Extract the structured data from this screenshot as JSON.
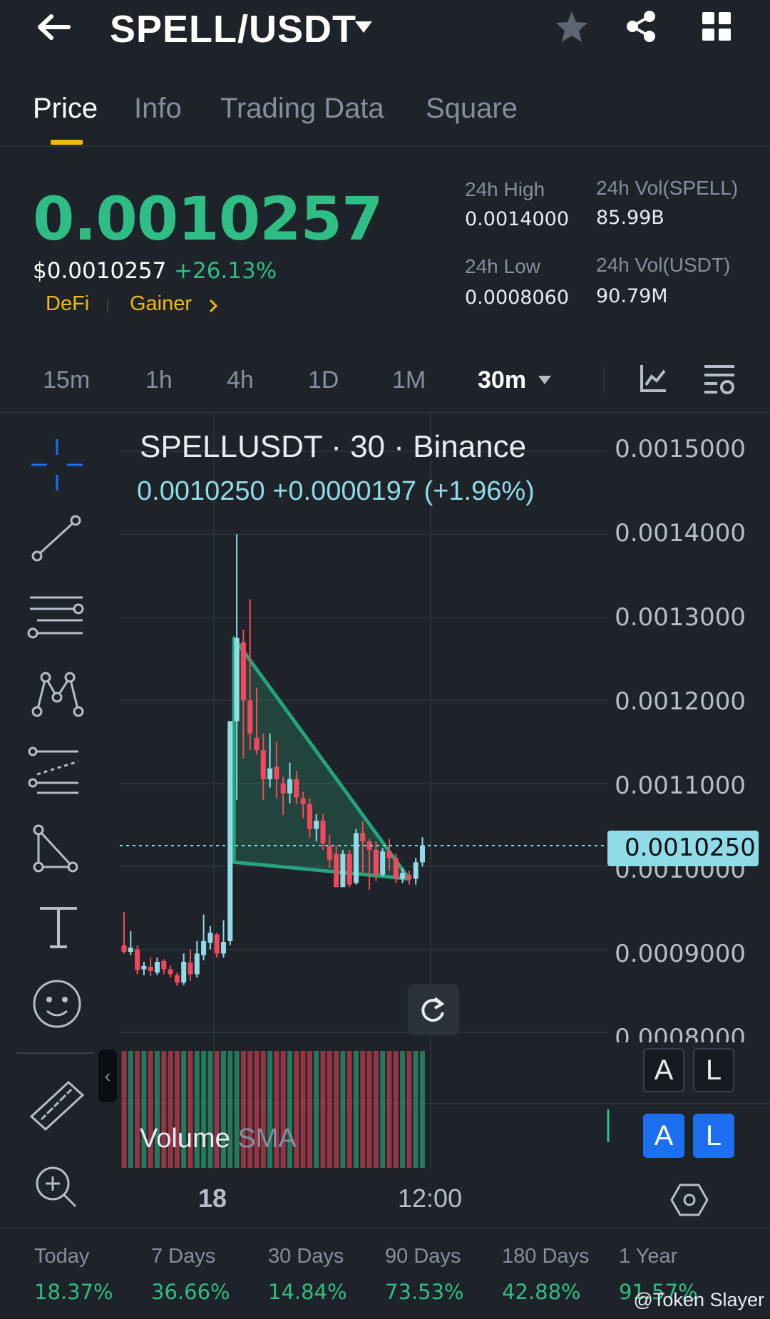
{
  "header": {
    "back_icon": "arrow-left-icon",
    "pair": "SPELL/USDT",
    "dropdown_icon": "caret-down-icon",
    "actions": [
      "star-icon",
      "share-icon",
      "grid-icon"
    ]
  },
  "tabs": [
    {
      "label": "Price",
      "active": true
    },
    {
      "label": "Info"
    },
    {
      "label": "Trading Data"
    },
    {
      "label": "Square"
    }
  ],
  "ticker": {
    "last_price": "0.0010257",
    "usd_price": "$0.0010257",
    "change_pct": "+26.13%",
    "tags": [
      "DeFi",
      "Gainer"
    ],
    "high_label": "24h High",
    "high_value": "0.0014000",
    "low_label": "24h Low",
    "low_value": "0.0008060",
    "vol_base_label": "24h Vol(SPELL)",
    "vol_base_value": "85.99B",
    "vol_quote_label": "24h Vol(USDT)",
    "vol_quote_value": "90.79M",
    "color_up": "#2ebd85",
    "color_down": "#f6465d",
    "accent": "#f0b90b"
  },
  "timeframes": {
    "items": [
      "15m",
      "1h",
      "4h",
      "1D",
      "1M"
    ],
    "selected": "30m"
  },
  "chart": {
    "title": "SPELLUSDT · 30 · Binance",
    "ohlc_line": "0.0010250  +0.0000197 (+1.96%)",
    "last_price_label": "0.0010250",
    "volume_label": "Volume",
    "volume_sma_label": "SMA",
    "x_labels": [
      "18",
      "12:00"
    ],
    "y_labels": [
      "0.0015000",
      "0.0014000",
      "0.0013000",
      "0.0012000",
      "0.0011000",
      "0.0010000",
      "0.0009000",
      "0.0008000"
    ],
    "buttons": {
      "a_dark": "A",
      "l_dark": "L",
      "a_blue": "A",
      "l_blue": "L"
    }
  },
  "chart_data": {
    "type": "candlestick",
    "title": "SPELLUSDT · 30 · Binance",
    "x_ticks": [
      "18",
      "12:00"
    ],
    "ylim": [
      0.0008,
      0.0015
    ],
    "last": 0.001025,
    "series": [
      {
        "o": 0.000905,
        "h": 0.000945,
        "l": 0.000895,
        "c": 0.000897
      },
      {
        "o": 0.000897,
        "h": 0.000922,
        "l": 0.000893,
        "c": 0.000902
      },
      {
        "o": 0.0009,
        "h": 0.000905,
        "l": 0.00087,
        "c": 0.000875
      },
      {
        "o": 0.000876,
        "h": 0.000885,
        "l": 0.000869,
        "c": 0.00088
      },
      {
        "o": 0.000879,
        "h": 0.00089,
        "l": 0.000868,
        "c": 0.000874
      },
      {
        "o": 0.000872,
        "h": 0.00089,
        "l": 0.000869,
        "c": 0.000885
      },
      {
        "o": 0.000886,
        "h": 0.000888,
        "l": 0.00087,
        "c": 0.000876
      },
      {
        "o": 0.000876,
        "h": 0.00088,
        "l": 0.000866,
        "c": 0.00087
      },
      {
        "o": 0.000869,
        "h": 0.000872,
        "l": 0.000856,
        "c": 0.00086
      },
      {
        "o": 0.00086,
        "h": 0.000895,
        "l": 0.000857,
        "c": 0.000885
      },
      {
        "o": 0.000884,
        "h": 0.0009,
        "l": 0.000862,
        "c": 0.00087
      },
      {
        "o": 0.00087,
        "h": 0.00091,
        "l": 0.000866,
        "c": 0.000895
      },
      {
        "o": 0.000893,
        "h": 0.000942,
        "l": 0.000887,
        "c": 0.00091
      },
      {
        "o": 0.000908,
        "h": 0.000928,
        "l": 0.0009,
        "c": 0.00092
      },
      {
        "o": 0.000918,
        "h": 0.00092,
        "l": 0.00089,
        "c": 0.000895
      },
      {
        "o": 0.000895,
        "h": 0.000935,
        "l": 0.00089,
        "c": 0.000909
      },
      {
        "o": 0.00091,
        "h": 0.001175,
        "l": 0.000905,
        "c": 0.001175
      },
      {
        "o": 0.001175,
        "h": 0.0014,
        "l": 0.00108,
        "c": 0.001275
      },
      {
        "o": 0.00127,
        "h": 0.001285,
        "l": 0.00113,
        "c": 0.0012
      },
      {
        "o": 0.0012,
        "h": 0.001322,
        "l": 0.00114,
        "c": 0.00116
      },
      {
        "o": 0.001155,
        "h": 0.001215,
        "l": 0.001135,
        "c": 0.00114
      },
      {
        "o": 0.00114,
        "h": 0.00116,
        "l": 0.00108,
        "c": 0.001105
      },
      {
        "o": 0.001105,
        "h": 0.00116,
        "l": 0.001095,
        "c": 0.001118
      },
      {
        "o": 0.00112,
        "h": 0.00115,
        "l": 0.001082,
        "c": 0.001105
      },
      {
        "o": 0.0011,
        "h": 0.001108,
        "l": 0.001062,
        "c": 0.001088
      },
      {
        "o": 0.001088,
        "h": 0.001125,
        "l": 0.001076,
        "c": 0.001105
      },
      {
        "o": 0.001105,
        "h": 0.001115,
        "l": 0.001075,
        "c": 0.001083
      },
      {
        "o": 0.001082,
        "h": 0.00109,
        "l": 0.001058,
        "c": 0.001075
      },
      {
        "o": 0.001075,
        "h": 0.001082,
        "l": 0.001035,
        "c": 0.001045
      },
      {
        "o": 0.001045,
        "h": 0.001063,
        "l": 0.00103,
        "c": 0.001055
      },
      {
        "o": 0.001055,
        "h": 0.001063,
        "l": 0.00102,
        "c": 0.001028
      },
      {
        "o": 0.001025,
        "h": 0.001038,
        "l": 0.000998,
        "c": 0.001008
      },
      {
        "o": 0.001015,
        "h": 0.001025,
        "l": 0.000975,
        "c": 0.000975
      },
      {
        "o": 0.000975,
        "h": 0.00102,
        "l": 0.000975,
        "c": 0.001015
      },
      {
        "o": 0.001015,
        "h": 0.00102,
        "l": 0.000975,
        "c": 0.000978
      },
      {
        "o": 0.00098,
        "h": 0.001045,
        "l": 0.000978,
        "c": 0.00104
      },
      {
        "o": 0.00104,
        "h": 0.001055,
        "l": 0.000992,
        "c": 0.00103
      },
      {
        "o": 0.00103,
        "h": 0.001033,
        "l": 0.000972,
        "c": 0.00102
      },
      {
        "o": 0.00102,
        "h": 0.00103,
        "l": 0.000982,
        "c": 0.00099
      },
      {
        "o": 0.00099,
        "h": 0.001022,
        "l": 0.000988,
        "c": 0.001018
      },
      {
        "o": 0.001018,
        "h": 0.001033,
        "l": 0.000995,
        "c": 0.00101
      },
      {
        "o": 0.00101,
        "h": 0.001015,
        "l": 0.00098,
        "c": 0.000985
      },
      {
        "o": 0.000985,
        "h": 0.000998,
        "l": 0.00098,
        "c": 0.000992
      },
      {
        "o": 0.00099,
        "h": 0.000995,
        "l": 0.000978,
        "c": 0.000985
      },
      {
        "o": 0.000985,
        "h": 0.00101,
        "l": 0.000978,
        "c": 0.001005
      },
      {
        "o": 0.001005,
        "h": 0.001035,
        "l": 0.001,
        "c": 0.001025
      }
    ],
    "triangle": [
      {
        "i": 17,
        "price": 0.001275
      },
      {
        "i": 43,
        "price": 0.000985
      },
      {
        "i": 17,
        "price": 0.001005
      }
    ]
  },
  "drawing_tools": [
    "crosshair-icon",
    "trend-line-icon",
    "horizontal-lines-icon",
    "pattern-icon",
    "fib-icon",
    "triangle-tool-icon",
    "text-tool-icon",
    "emoji-icon",
    "ruler-icon",
    "zoom-in-icon"
  ],
  "performance": [
    {
      "label": "Today",
      "value": "18.37%"
    },
    {
      "label": "7 Days",
      "value": "36.66%"
    },
    {
      "label": "30 Days",
      "value": "14.84%"
    },
    {
      "label": "90 Days",
      "value": "73.53%"
    },
    {
      "label": "180 Days",
      "value": "42.88%"
    },
    {
      "label": "1 Year",
      "value": "91.57%"
    }
  ],
  "watermark": "@Token Slayer"
}
